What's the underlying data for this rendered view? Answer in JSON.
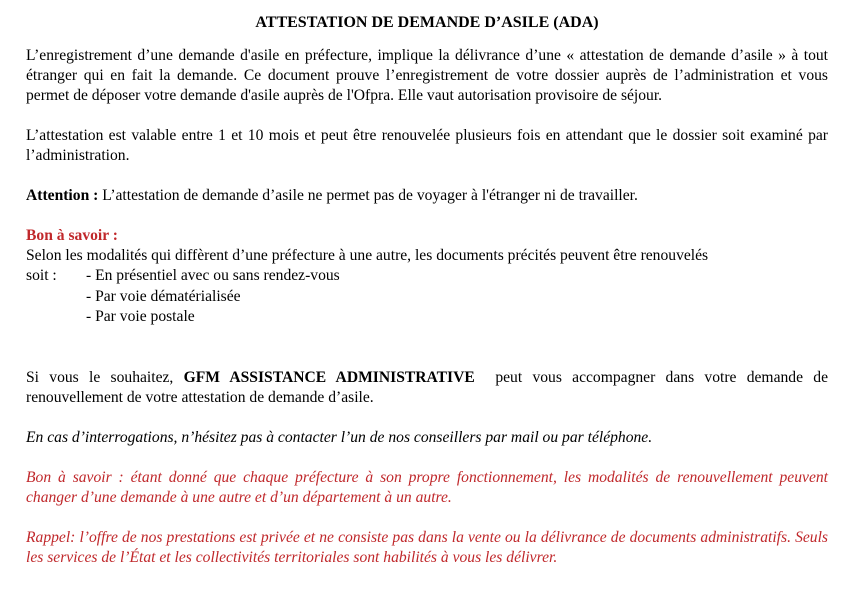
{
  "document": {
    "title": "ATTESTATION DE DEMANDE D’ASILE (ADA)",
    "intro": "L’enregistrement d’une demande d'asile en préfecture, implique la délivrance d’une « attestation de demande d’asile » à tout étranger qui en fait la demande. Ce document prouve l’enregistrement de votre dossier auprès de l’administration et vous permet de déposer votre demande d'asile auprès de l'Ofpra. Elle vaut autorisation provisoire de séjour.",
    "validity": "L’attestation est valable entre 1 et 10 mois et peut être renouvelée plusieurs fois en attendant que le dossier soit examiné par l’administration.",
    "attention_label": "Attention :",
    "attention_text": " L’attestation de demande d’asile ne permet pas de voyager à l'étranger ni de travailler.",
    "good_to_know_label": "Bon à savoir :",
    "good_to_know_text": "Selon les modalités qui diffèrent d’une préfecture à une autre, les documents précités peuvent être renouvelés",
    "list_lead": "soit :",
    "list_items": [
      "- En présentiel avec ou sans rendez-vous",
      "- Par voie dématérialisée",
      "- Par voie postale"
    ],
    "assist_pre": "Si vous le souhaitez, ",
    "assist_company": "GFM ASSISTANCE ADMINISTRATIVE",
    "assist_post": "  peut vous accompagner dans votre demande de renouvellement de votre attestation de demande d’asile.",
    "contact": "En cas d’interrogations, n’hésitez pas à contacter l’un de nos conseillers par mail ou par téléphone.",
    "note_prefecture": "Bon à savoir : étant donné que chaque préfecture à son propre fonctionnement, les modalités de renouvellement peuvent changer d’une demande à une autre et d’un département à un autre.",
    "reminder": "Rappel: l’offre de nos prestations est privée et ne consiste pas dans la vente ou la délivrance de documents administratifs. Seuls les services de l’État et les collectivités territoriales sont habilités à vous les délivrer."
  },
  "colors": {
    "text": "#000000",
    "accent_red": "#c0282b",
    "background": "#ffffff"
  }
}
